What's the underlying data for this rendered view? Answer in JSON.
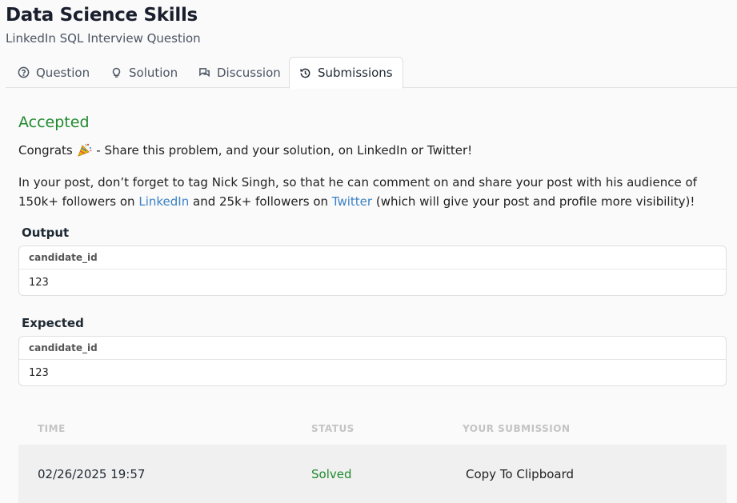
{
  "header": {
    "title": "Data Science Skills",
    "subtitle": "LinkedIn SQL Interview Question"
  },
  "tabs": [
    {
      "label": "Question",
      "icon": "question-circle-icon"
    },
    {
      "label": "Solution",
      "icon": "lightbulb-icon"
    },
    {
      "label": "Discussion",
      "icon": "chat-bubbles-icon"
    },
    {
      "label": "Submissions",
      "icon": "history-icon",
      "active": true
    }
  ],
  "status": {
    "accepted": "Accepted",
    "congrats_prefix": "Congrats",
    "congrats_suffix": "- Share this problem, and your solution, on LinkedIn or Twitter!",
    "post_text_1": "In your post, don’t forget to tag Nick Singh, so that he can comment on and share your post with his audience of 150k+ followers on",
    "linkedin_link": "LinkedIn",
    "post_text_2": "and 25k+ followers on",
    "twitter_link": "Twitter",
    "post_text_3": "(which will give your post and profile more visibility)!"
  },
  "output": {
    "label": "Output",
    "column": "candidate_id",
    "value": "123"
  },
  "expected": {
    "label": "Expected",
    "column": "candidate_id",
    "value": "123"
  },
  "submissions": {
    "headers": {
      "time": "TIME",
      "status": "STATUS",
      "submission": "YOUR SUBMISSION"
    },
    "rows": [
      {
        "time": "02/26/2025 19:57",
        "status": "Solved",
        "action": "Copy To Clipboard"
      }
    ]
  },
  "colors": {
    "accent_green": "#1f8a2e",
    "link_blue": "#3b82c4"
  }
}
